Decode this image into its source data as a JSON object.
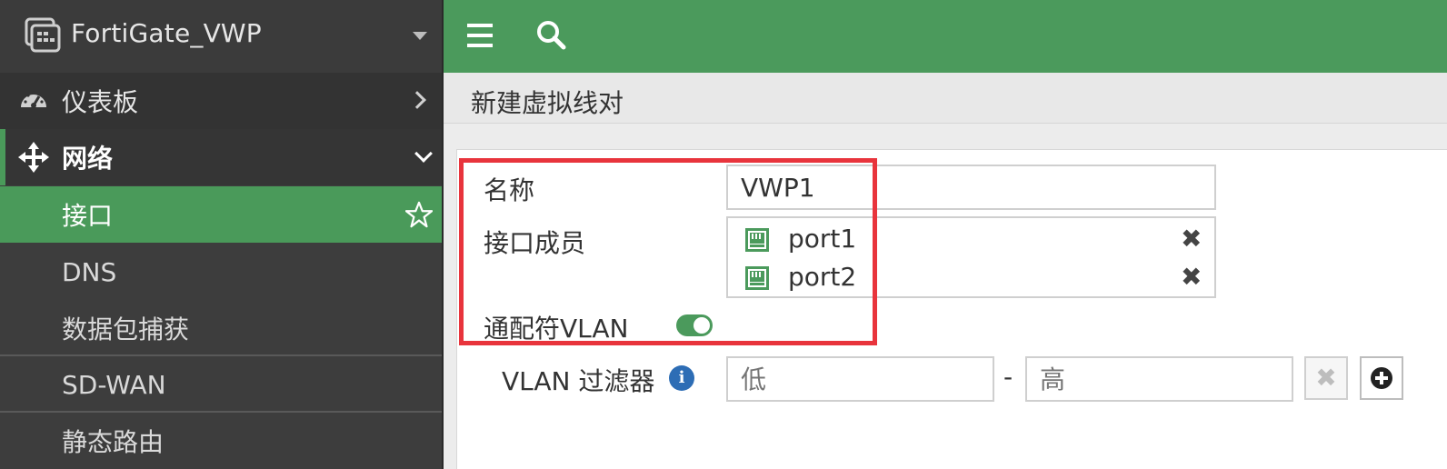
{
  "sidebar": {
    "device_name": "FortiGate_VWP",
    "items": [
      {
        "label": "仪表板"
      },
      {
        "label": "网络"
      },
      {
        "label": "接口"
      },
      {
        "label": "DNS"
      },
      {
        "label": "数据包捕获"
      },
      {
        "label": "SD-WAN"
      },
      {
        "label": "静态路由"
      }
    ]
  },
  "page": {
    "title": "新建虚拟线对"
  },
  "form": {
    "name_label": "名称",
    "name_value": "VWP1",
    "members_label": "接口成员",
    "members": [
      {
        "label": "port1"
      },
      {
        "label": "port2"
      }
    ],
    "remove_glyph": "✖",
    "wildcard_vlan_label": "通配符VLAN",
    "wildcard_vlan_enabled": true,
    "vlan_filter_label": "VLAN 过滤器",
    "vlan_low_placeholder": "低",
    "vlan_high_placeholder": "高",
    "range_separator": "-",
    "clear_glyph": "✖"
  },
  "colors": {
    "accent_green": "#4b9a5c",
    "highlight_red": "#e8343c",
    "sidebar_bg": "#3d3d3d"
  }
}
